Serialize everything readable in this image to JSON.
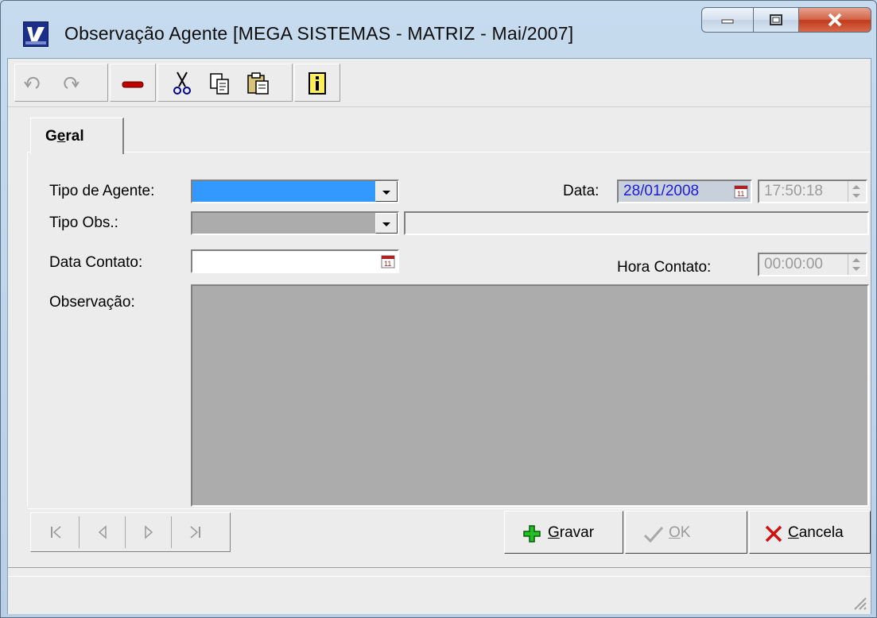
{
  "window": {
    "title": "Observação Agente [MEGA SISTEMAS - MATRIZ - Mai/2007]",
    "controls": {
      "minimize": "minimize",
      "maximize": "maximize",
      "close": "close"
    }
  },
  "toolbar": {
    "buttons": [
      {
        "icon": "undo-icon",
        "enabled": false
      },
      {
        "icon": "redo-icon",
        "enabled": false
      },
      {
        "icon": "delete-icon",
        "enabled": true
      },
      {
        "icon": "cut-icon",
        "enabled": true
      },
      {
        "icon": "copy-icon",
        "enabled": true
      },
      {
        "icon": "paste-icon",
        "enabled": true
      },
      {
        "icon": "info-icon",
        "enabled": true
      }
    ]
  },
  "tabs": [
    {
      "label": "Geral",
      "accesskey": "e",
      "active": true
    }
  ],
  "form": {
    "tipo_agente": {
      "label": "Tipo de Agente:",
      "value": ""
    },
    "data": {
      "label": "Data:",
      "value": "28/01/2008",
      "time": "17:50:18"
    },
    "tipo_obs": {
      "label": "Tipo Obs.:",
      "value": "",
      "description": ""
    },
    "data_contato": {
      "label": "Data Contato:",
      "value": ""
    },
    "hora_contato": {
      "label": "Hora Contato:",
      "value": "00:00:00"
    },
    "observacao": {
      "label": "Observação:",
      "value": ""
    }
  },
  "navigation": [
    "first",
    "previous",
    "next",
    "last"
  ],
  "actions": {
    "gravar": {
      "label": "Gravar",
      "accesskey": "G",
      "enabled": true
    },
    "ok": {
      "label": "OK",
      "accesskey": "O",
      "enabled": false
    },
    "cancela": {
      "label": "Cancela",
      "accesskey": "C",
      "enabled": true
    }
  },
  "colors": {
    "selection": "#3399ff",
    "disabled_field": "#acacac",
    "date_text": "#1c1cd8"
  }
}
